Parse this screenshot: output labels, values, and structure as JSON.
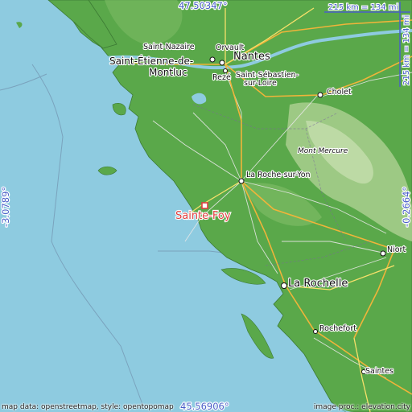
{
  "coords": {
    "top": "47.50347°",
    "bottom": "45.56906°",
    "left": "-3.0789°",
    "right": "-0.2664°"
  },
  "scale": {
    "top": "215 km = 134 mi",
    "right": "215 km = 134 mi"
  },
  "places": {
    "saint_nazaire": "Saint-Nazaire",
    "orvault": "Orvault",
    "nantes": "Nantes",
    "saint_etienne_1": "Saint-Étienne-de-",
    "saint_etienne_2": "Montluc",
    "reze": "Rezé",
    "saint_sebastien_1": "Saint-Sébastien-",
    "saint_sebastien_2": "sur-Loire",
    "cholet": "Cholet",
    "mont_mercure": "Mont Mercure",
    "la_roche": "La Roche-sur-Yon",
    "sainte_foy": "Sainte-Foy",
    "niort": "Niort",
    "la_rochelle": "La Rochelle",
    "rochefort": "Rochefort",
    "saintes": "Saintes"
  },
  "credits": {
    "left": "map data: openstreetmap, style: opentopomap",
    "right": "image proc.: elevation.city"
  },
  "colors": {
    "sea": "#8ecbe0",
    "land": "#5aa84a",
    "highland": "#a9cf8e",
    "marker": "#e04040",
    "coord_text": "#4a5fc8"
  }
}
